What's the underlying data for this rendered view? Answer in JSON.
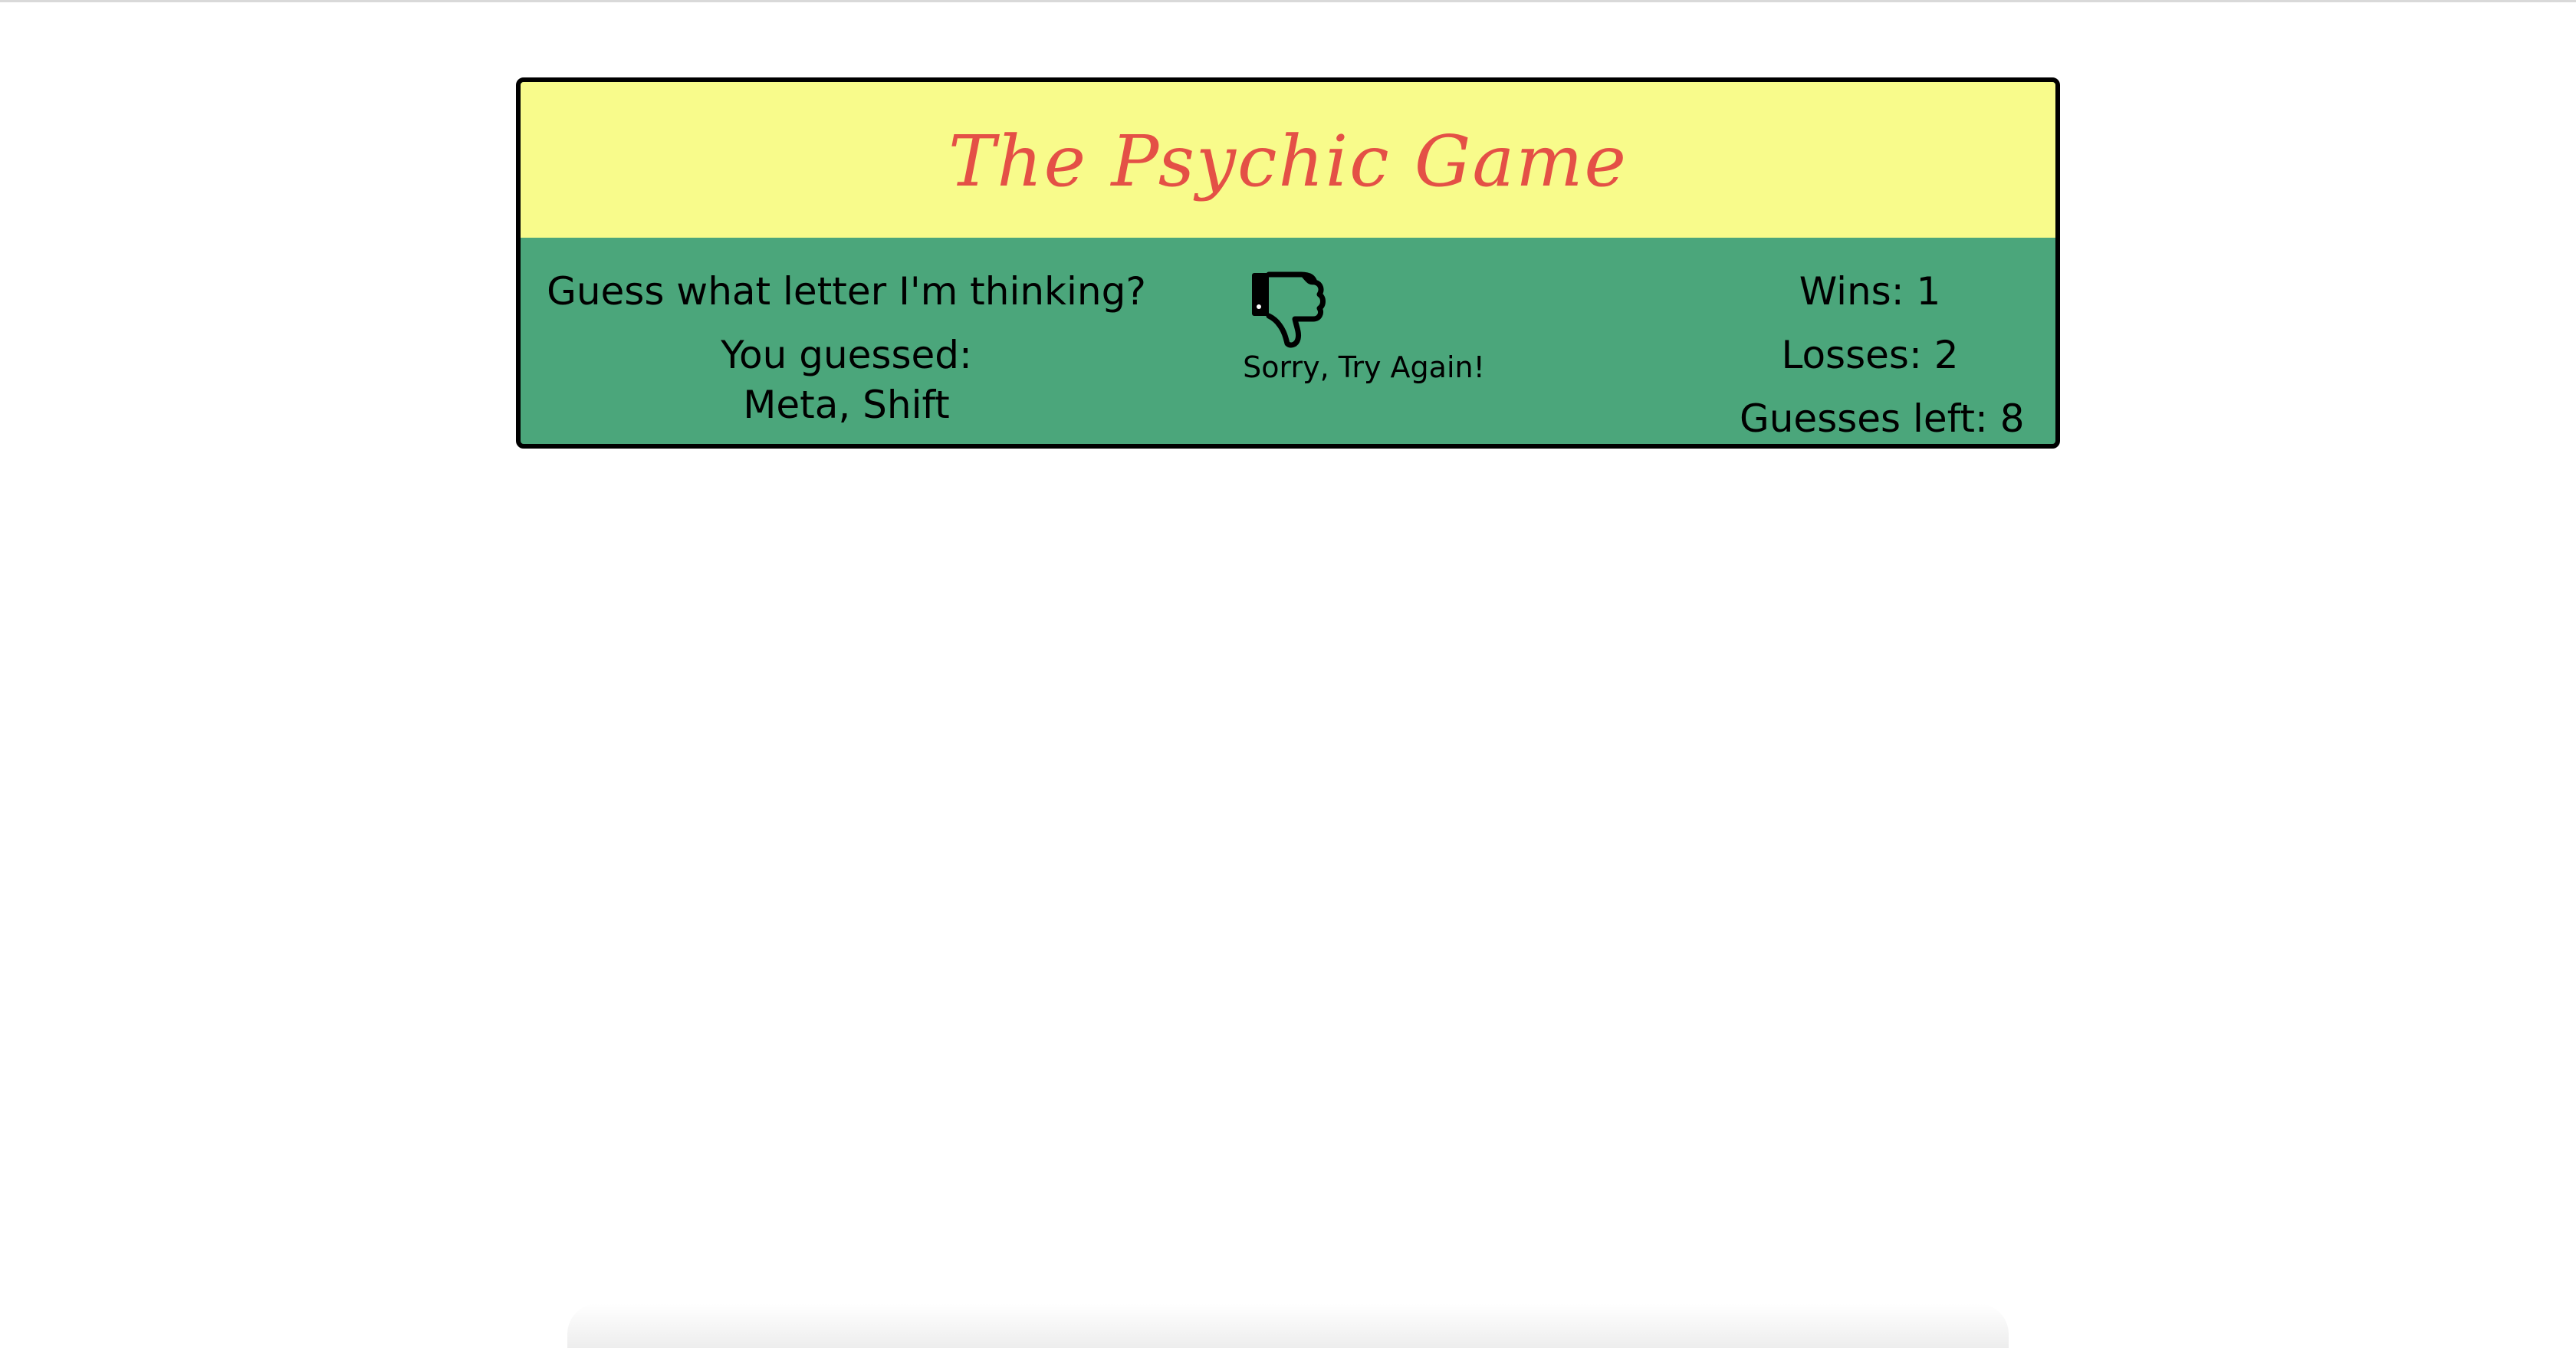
{
  "game": {
    "title": "The Psychic Game",
    "prompt": "Guess what letter I'm thinking?",
    "guessed_label": "You guessed:",
    "guessed_value": "Meta, Shift",
    "result_icon": "thumbs-down-icon",
    "result_message": "Sorry, Try Again!",
    "wins_text": "Wins: 1",
    "losses_text": "Losses: 2",
    "guesses_left_text": "Guesses left: 8"
  },
  "colors": {
    "header_bg": "#f8fb8b",
    "body_bg": "#4ba67b",
    "title_color": "#e45046",
    "border": "#000000"
  }
}
